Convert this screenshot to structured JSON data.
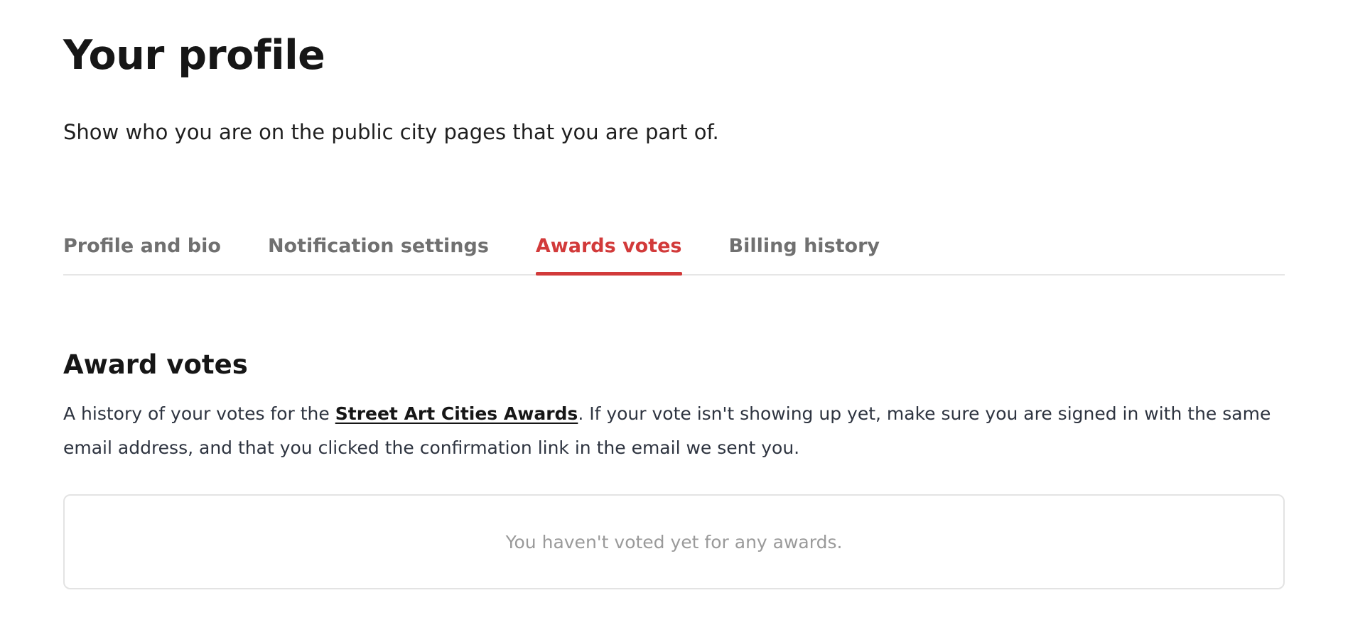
{
  "header": {
    "title": "Your profile",
    "subtitle": "Show who you are on the public city pages that you are part of."
  },
  "tabs": [
    {
      "label": "Profile and bio",
      "active": false
    },
    {
      "label": "Notification settings",
      "active": false
    },
    {
      "label": "Awards votes",
      "active": true
    },
    {
      "label": "Billing history",
      "active": false
    }
  ],
  "section": {
    "title": "Award votes",
    "desc_before": "A history of your votes for the ",
    "link_text": "Street Art Cities Awards",
    "desc_after": ". If your vote isn't showing up yet, make sure you are signed in with the same email address, and that you clicked the confirmation link in the email we sent you.",
    "empty_message": "You haven't voted yet for any awards."
  },
  "colors": {
    "accent": "#d23a3a",
    "tab_inactive": "#707070",
    "text": "#161616",
    "muted": "#9a9a9a",
    "border": "#e3e3e3"
  }
}
